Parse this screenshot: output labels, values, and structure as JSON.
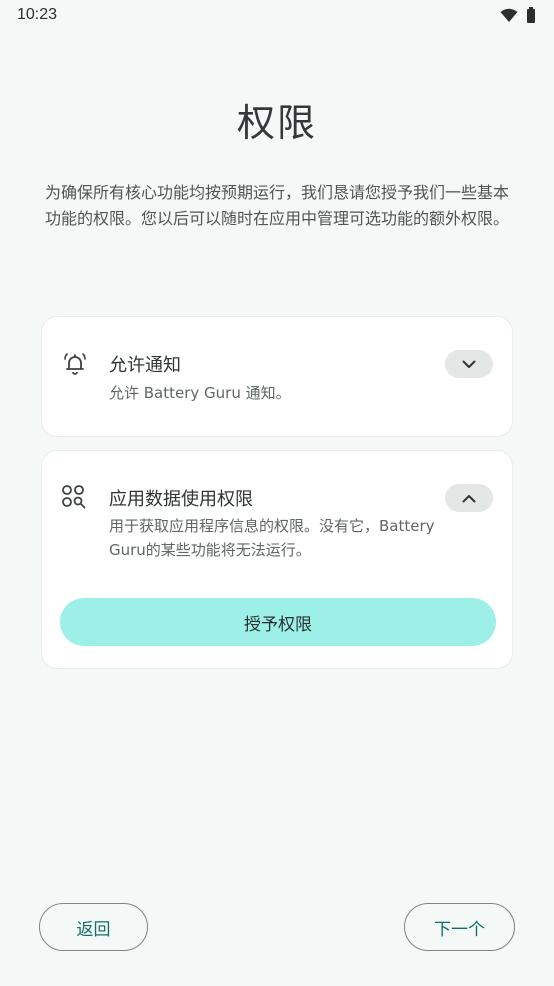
{
  "status_bar": {
    "time": "10:23",
    "icons": [
      "wifi-icon",
      "battery-icon"
    ]
  },
  "title": "权限",
  "description": "为确保所有核心功能均按预期运行，我们恳请您授予我们一些基本功能的权限。您以后可以随时在应用中管理可选功能的额外权限。",
  "permissions": [
    {
      "icon": "bell-icon",
      "title": "允许通知",
      "description": "允许 Battery Guru 通知。",
      "expanded": false
    },
    {
      "icon": "app-usage-icon",
      "title": "应用数据使用权限",
      "description": "用于获取应用程序信息的权限。没有它，Battery Guru的某些功能将无法运行。",
      "expanded": true,
      "button_label": "授予权限"
    }
  ],
  "navigation": {
    "back_label": "返回",
    "next_label": "下一个"
  },
  "colors": {
    "background": "#f4f8f6",
    "accent": "#9df0e8",
    "nav_text": "#0f6f66"
  }
}
